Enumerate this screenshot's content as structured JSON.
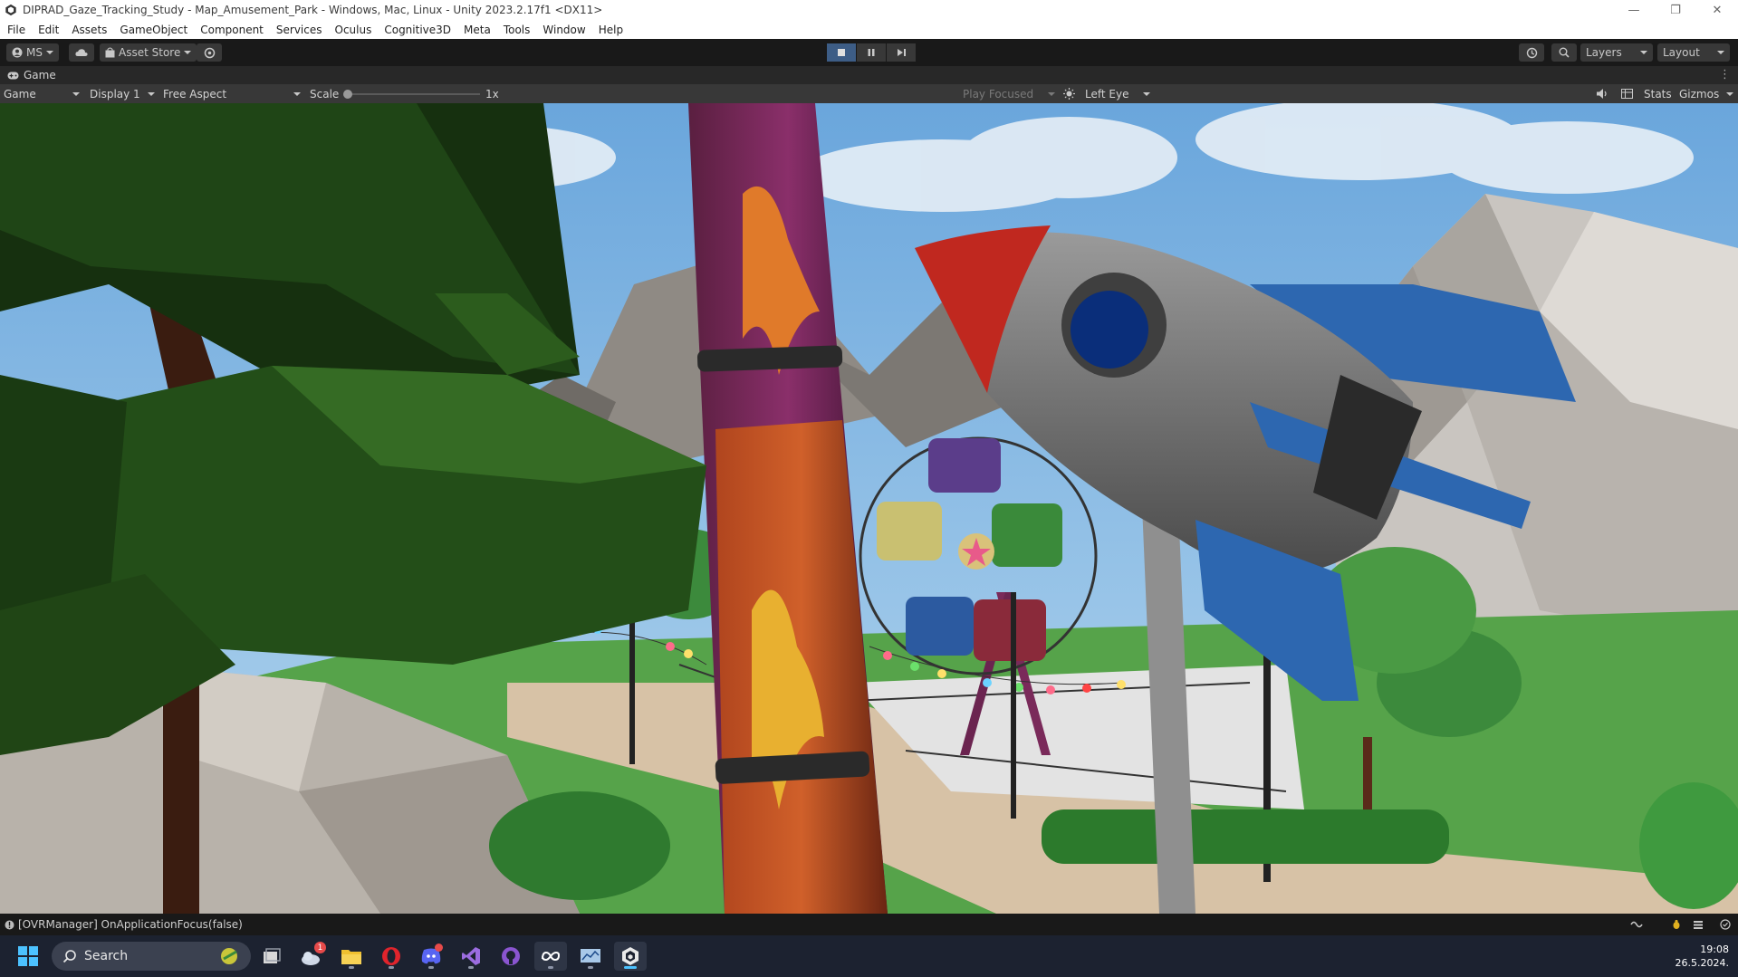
{
  "window": {
    "title": "DIPRAD_Gaze_Tracking_Study - Map_Amusement_Park - Windows, Mac, Linux - Unity 2023.2.17f1 <DX11>",
    "controls": {
      "minimize": "—",
      "restore": "❐",
      "close": "✕"
    }
  },
  "menu": [
    "File",
    "Edit",
    "Assets",
    "GameObject",
    "Component",
    "Services",
    "Oculus",
    "Cognitive3D",
    "Meta",
    "Tools",
    "Window",
    "Help"
  ],
  "toolbar": {
    "account_label": "MS",
    "asset_store_label": "Asset Store",
    "layers_label": "Layers",
    "layout_label": "Layout"
  },
  "game_tab": {
    "label": "Game"
  },
  "game_view": {
    "mode": "Game",
    "display": "Display 1",
    "aspect": "Free Aspect",
    "scale_label": "Scale",
    "scale_value": "1x",
    "scale_level": 0,
    "play_focused": "Play Focused",
    "eye": "Left Eye",
    "stats_label": "Stats",
    "gizmos_label": "Gizmos"
  },
  "console": {
    "message": "[OVRManager] OnApplicationFocus(false)"
  },
  "taskbar": {
    "search_placeholder": "Search",
    "weather_badge": "1",
    "apps": [
      "task-view",
      "weather",
      "file-explorer",
      "opera",
      "discord",
      "visual-studio",
      "github-desktop",
      "meta-quest-link",
      "resource-monitor",
      "unity"
    ],
    "time": "19:08",
    "date": "26.5.2024."
  },
  "colors": {
    "title_bg": "#ffffff",
    "toolbar_bg": "#191919",
    "panel_bg": "#383838",
    "play_active": "#3d5d86",
    "taskbar_bg": "#1c2230",
    "accent": "#4cc2ff"
  }
}
